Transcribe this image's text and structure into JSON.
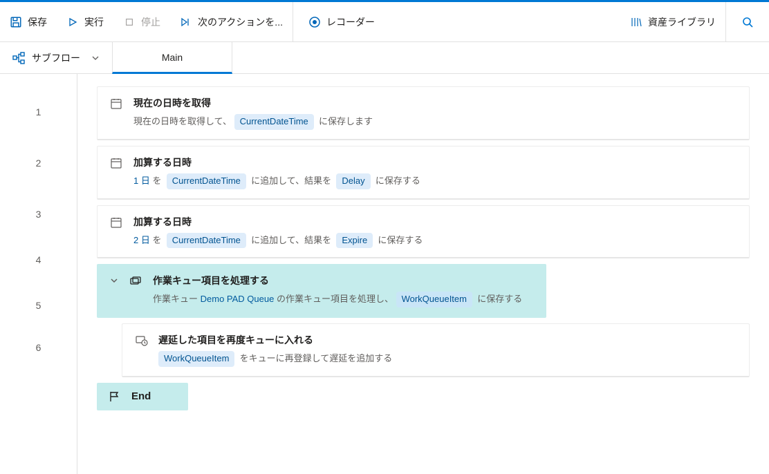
{
  "toolbar": {
    "save": "保存",
    "run": "実行",
    "stop": "停止",
    "next": "次のアクションを...",
    "record": "レコーダー",
    "assets": "資産ライブラリ"
  },
  "subflow": {
    "label": "サブフロー",
    "tab": "Main"
  },
  "lines": [
    "1",
    "2",
    "3",
    "4",
    "5",
    "6"
  ],
  "actions": {
    "a1": {
      "title": "現在の日時を取得",
      "d1": "現在の日時を取得して、 ",
      "v1": "CurrentDateTime",
      "d2": "  に保存します"
    },
    "a2": {
      "title": "加算する日時",
      "d1": "1 日 ",
      "d2": "を  ",
      "v1": "CurrentDateTime",
      "d3": "  に追加して、結果を  ",
      "v2": "Delay",
      "d4": "  に保存する"
    },
    "a3": {
      "title": "加算する日時",
      "d1": "2 日 ",
      "d2": "を  ",
      "v1": "CurrentDateTime",
      "d3": "  に追加して、結果を  ",
      "v2": "Expire",
      "d4": "  に保存する"
    },
    "a4": {
      "title": "作業キュー項目を処理する",
      "d1": "作業キュー ",
      "q": "Demo PAD Queue",
      "d2": " の作業キュー項目を処理し、 ",
      "v1": "WorkQueueItem",
      "d3": "  に保存する"
    },
    "a5": {
      "title": "遅延した項目を再度キューに入れる",
      "v1": "WorkQueueItem",
      "d1": "  をキューに再登録して遅延を追加する"
    },
    "a6": {
      "title": "End"
    }
  }
}
